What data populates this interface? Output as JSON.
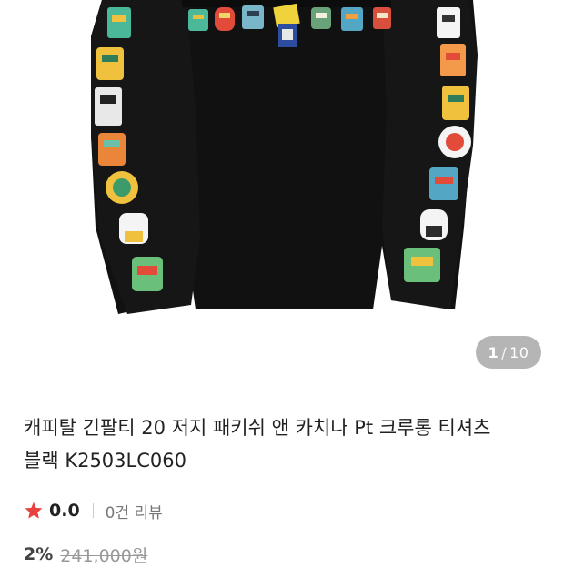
{
  "product": {
    "title_line1": "캐피탈 긴팔티 20 저지 패키쉬 앤 카치나 Pt 크루롱 티셔츠",
    "title_line2": "블랙 K2503LC060"
  },
  "gallery": {
    "current": "1",
    "separator": "/",
    "total": "10"
  },
  "rating": {
    "value": "0.0",
    "reviews_label": "0건 리뷰",
    "star_color": "#e8423f"
  },
  "price": {
    "discount": "2%",
    "original": "241,000원"
  }
}
